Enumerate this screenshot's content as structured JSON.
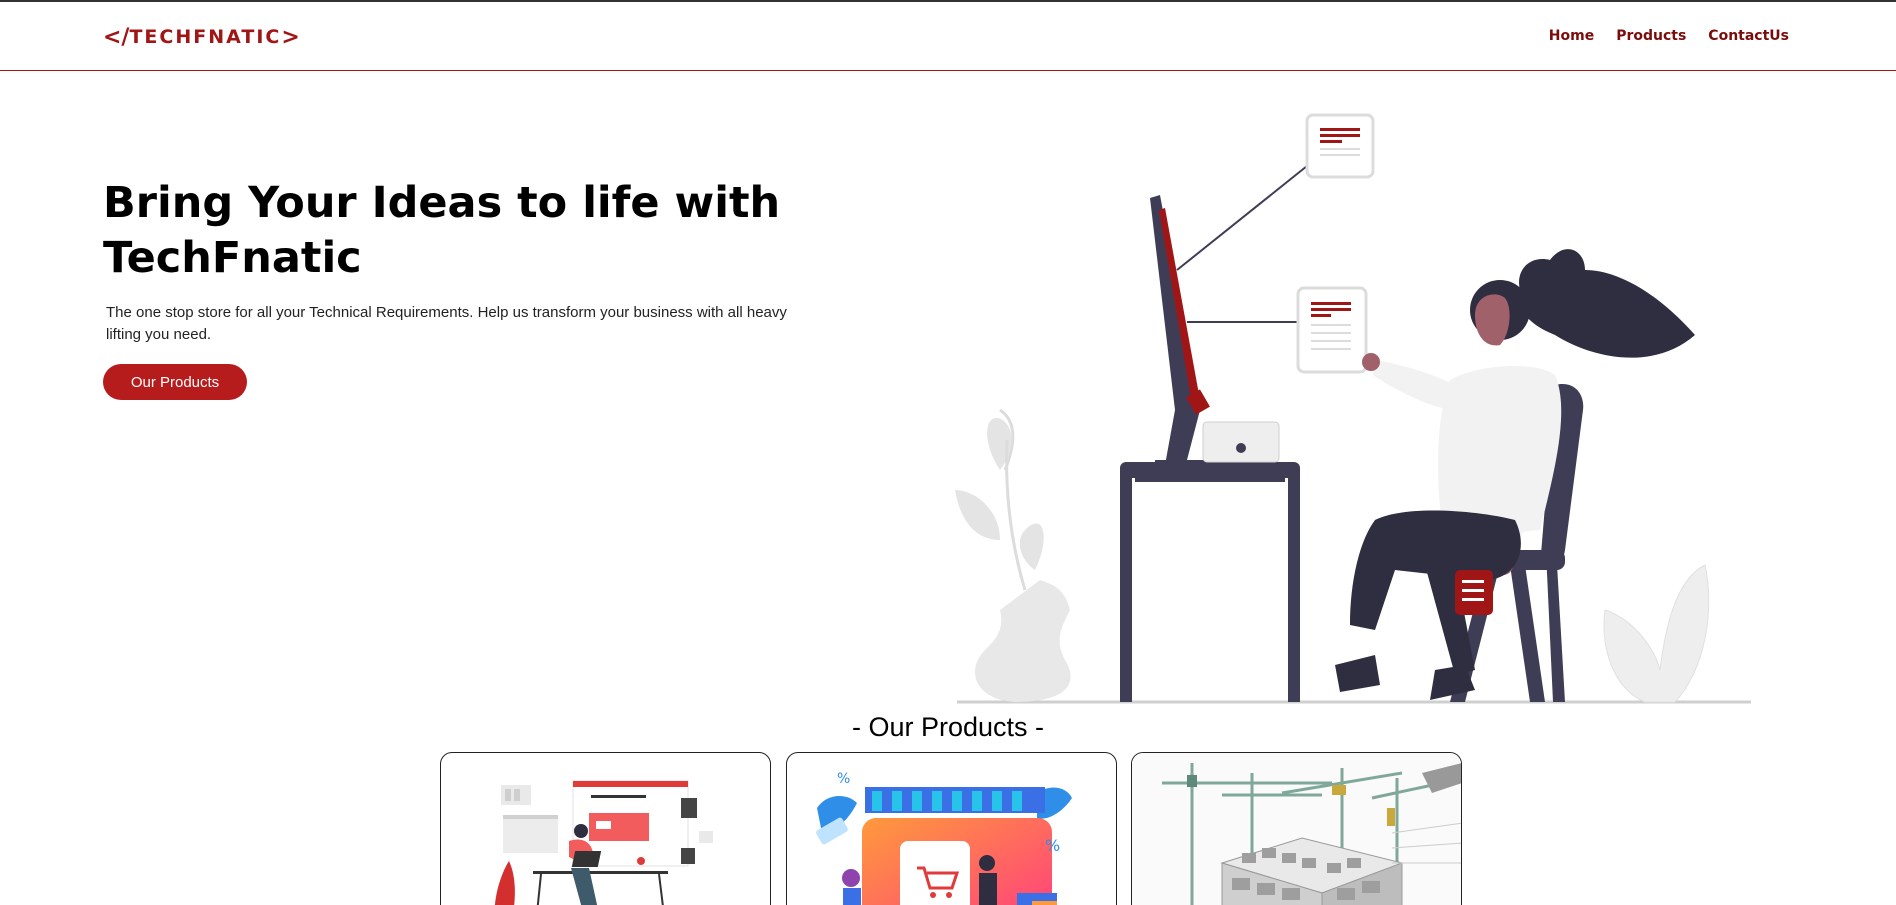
{
  "brand": {
    "logo_text": "TECHFNATIC",
    "logo_left": "</",
    "logo_right": ">",
    "primary_color": "#b71c1c",
    "nav_text_color": "#7a0c0c"
  },
  "nav": {
    "items": [
      {
        "label": "Home"
      },
      {
        "label": "Products"
      },
      {
        "label": "ContactUs"
      }
    ]
  },
  "hero": {
    "title": "Bring Your Ideas to life with TechFnatic",
    "description": "The one stop store for all your Technical Requirements. Help us transform your business with all heavy lifting you need.",
    "cta_label": "Our Products",
    "illustration_icon": "person-at-computer-illustration"
  },
  "products": {
    "section_title": "- Our Products -",
    "cards": [
      {
        "icon": "web-design-illustration"
      },
      {
        "icon": "online-shopping-illustration"
      },
      {
        "icon": "construction-cranes-illustration"
      }
    ]
  }
}
